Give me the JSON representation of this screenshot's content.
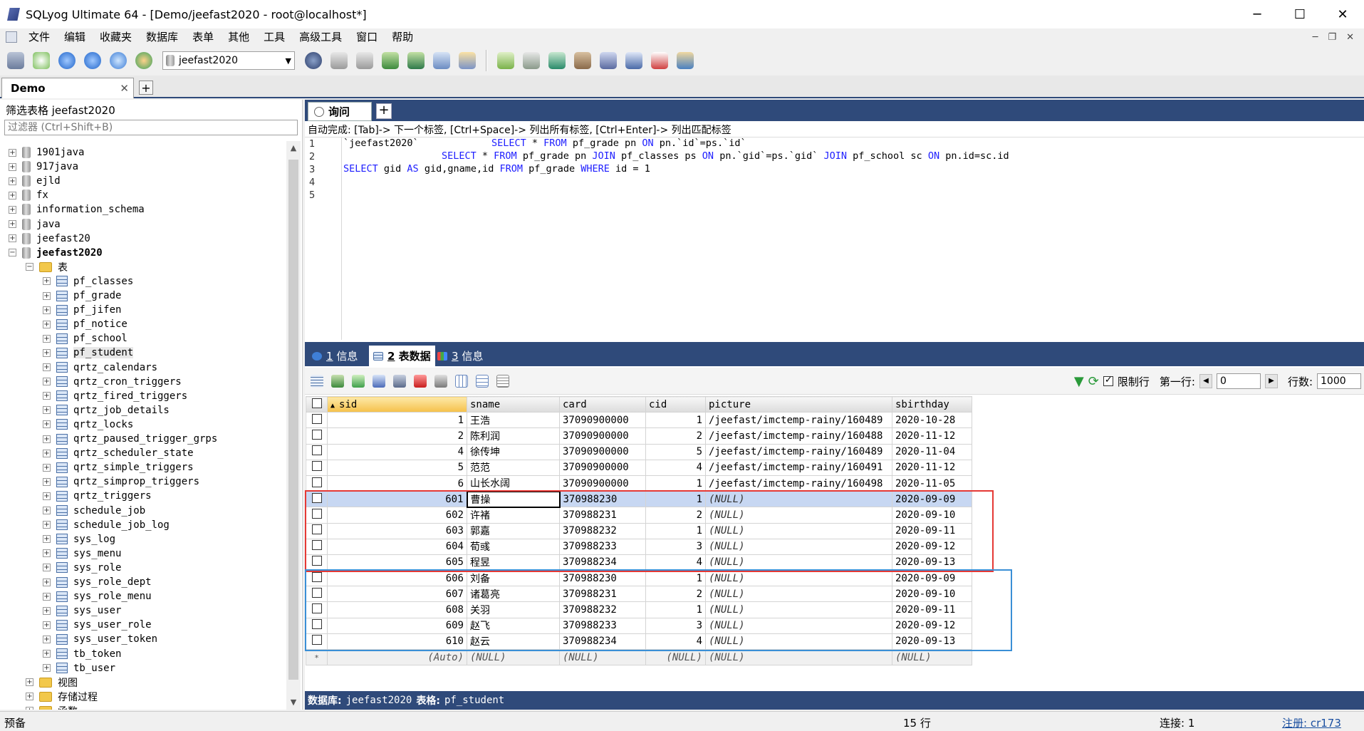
{
  "window": {
    "title": "SQLyog Ultimate 64 - [Demo/jeefast2020 - root@localhost*]"
  },
  "menu": [
    "文件",
    "编辑",
    "收藏夹",
    "数据库",
    "表单",
    "其他",
    "工具",
    "高级工具",
    "窗口",
    "帮助"
  ],
  "toolbar": {
    "db_selector": "jeefast2020"
  },
  "connection_tab": {
    "label": "Demo"
  },
  "filter": {
    "label": "筛选表格 jeefast2020",
    "placeholder": "过滤器 (Ctrl+Shift+B)"
  },
  "tree": {
    "databases": [
      "1901java",
      "917java",
      "ejld",
      "fx",
      "information_schema",
      "java",
      "jeefast20",
      "jeefast2020"
    ],
    "tables_folder": "表",
    "tables": [
      "pf_classes",
      "pf_grade",
      "pf_jifen",
      "pf_notice",
      "pf_school",
      "pf_student",
      "qrtz_calendars",
      "qrtz_cron_triggers",
      "qrtz_fired_triggers",
      "qrtz_job_details",
      "qrtz_locks",
      "qrtz_paused_trigger_grps",
      "qrtz_scheduler_state",
      "qrtz_simple_triggers",
      "qrtz_simprop_triggers",
      "qrtz_triggers",
      "schedule_job",
      "schedule_job_log",
      "sys_log",
      "sys_menu",
      "sys_role",
      "sys_role_dept",
      "sys_role_menu",
      "sys_user",
      "sys_user_role",
      "sys_user_token",
      "tb_token",
      "tb_user"
    ],
    "folders_after": [
      "视图",
      "存储过程",
      "函数"
    ]
  },
  "query_tab": {
    "label": "询问"
  },
  "autocomplete_hint": "自动完成: [Tab]-> 下一个标签, [Ctrl+Space]-> 列出所有标签, [Ctrl+Enter]-> 列出匹配标签",
  "editor": {
    "line_numbers": [
      "1",
      "2",
      "3",
      "4",
      "5"
    ],
    "line1_prefix": "`jeefast2020`",
    "line1": "SELECT * FROM pf_grade pn ON pn.`id`=ps.`id`",
    "line2": "SELECT * FROM pf_grade pn JOIN pf_classes ps ON pn.`gid`=ps.`gid` JOIN pf_school sc ON pn.id=sc.id",
    "line3": "SELECT gid AS gid,gname,id FROM pf_grade WHERE id = 1"
  },
  "result_tabs": [
    {
      "num": "1",
      "label": "信息"
    },
    {
      "num": "2",
      "label": "表数据"
    },
    {
      "num": "3",
      "label": "信息"
    }
  ],
  "grid_toolbar": {
    "limit_label": "限制行",
    "first_row_label": "第一行:",
    "first_row_value": "0",
    "rows_label": "行数:",
    "rows_value": "1000"
  },
  "grid": {
    "columns": [
      "sid",
      "sname",
      "card",
      "cid",
      "picture",
      "sbirthday"
    ],
    "rows": [
      [
        "1",
        "王浩",
        "37090900000",
        "1",
        "/jeefast/imctemp-rainy/160489",
        "2020-10-28"
      ],
      [
        "2",
        "陈利润",
        "37090900000",
        "2",
        "/jeefast/imctemp-rainy/160488",
        "2020-11-12"
      ],
      [
        "4",
        "徐传坤",
        "37090900000",
        "5",
        "/jeefast/imctemp-rainy/160489",
        "2020-11-04"
      ],
      [
        "5",
        "范范",
        "37090900000",
        "4",
        "/jeefast/imctemp-rainy/160491",
        "2020-11-12"
      ],
      [
        "6",
        "山长水阔",
        "37090900000",
        "1",
        "/jeefast/imctemp-rainy/160498",
        "2020-11-05"
      ],
      [
        "601",
        "曹操",
        "370988230",
        "1",
        "(NULL)",
        "2020-09-09"
      ],
      [
        "602",
        "许褚",
        "370988231",
        "2",
        "(NULL)",
        "2020-09-10"
      ],
      [
        "603",
        "郭嘉",
        "370988232",
        "1",
        "(NULL)",
        "2020-09-11"
      ],
      [
        "604",
        "荀彧",
        "370988233",
        "3",
        "(NULL)",
        "2020-09-12"
      ],
      [
        "605",
        "程昱",
        "370988234",
        "4",
        "(NULL)",
        "2020-09-13"
      ],
      [
        "606",
        "刘备",
        "370988230",
        "1",
        "(NULL)",
        "2020-09-09"
      ],
      [
        "607",
        "诸葛亮",
        "370988231",
        "2",
        "(NULL)",
        "2020-09-10"
      ],
      [
        "608",
        "关羽",
        "370988232",
        "1",
        "(NULL)",
        "2020-09-11"
      ],
      [
        "609",
        "赵飞",
        "370988233",
        "3",
        "(NULL)",
        "2020-09-12"
      ],
      [
        "610",
        "赵云",
        "370988234",
        "4",
        "(NULL)",
        "2020-09-13"
      ]
    ],
    "new_row": [
      "(Auto)",
      "(NULL)",
      "(NULL)",
      "(NULL)",
      "(NULL)",
      "(NULL)"
    ],
    "selected_row_index": 5,
    "highlight_colors": {
      "red_box": "#e53935",
      "blue_box": "#3a8fd6"
    }
  },
  "infobar": {
    "db_label": "数据库:",
    "db_value": "jeefast2020",
    "table_label": "表格:",
    "table_value": "pf_student"
  },
  "statusbar": {
    "left": "预备",
    "rows": "15 行",
    "connection": "连接: 1",
    "register": "注册: cr173"
  },
  "colors": {
    "header_blue": "#2f4a7a",
    "selection": "#c7d7f2"
  }
}
